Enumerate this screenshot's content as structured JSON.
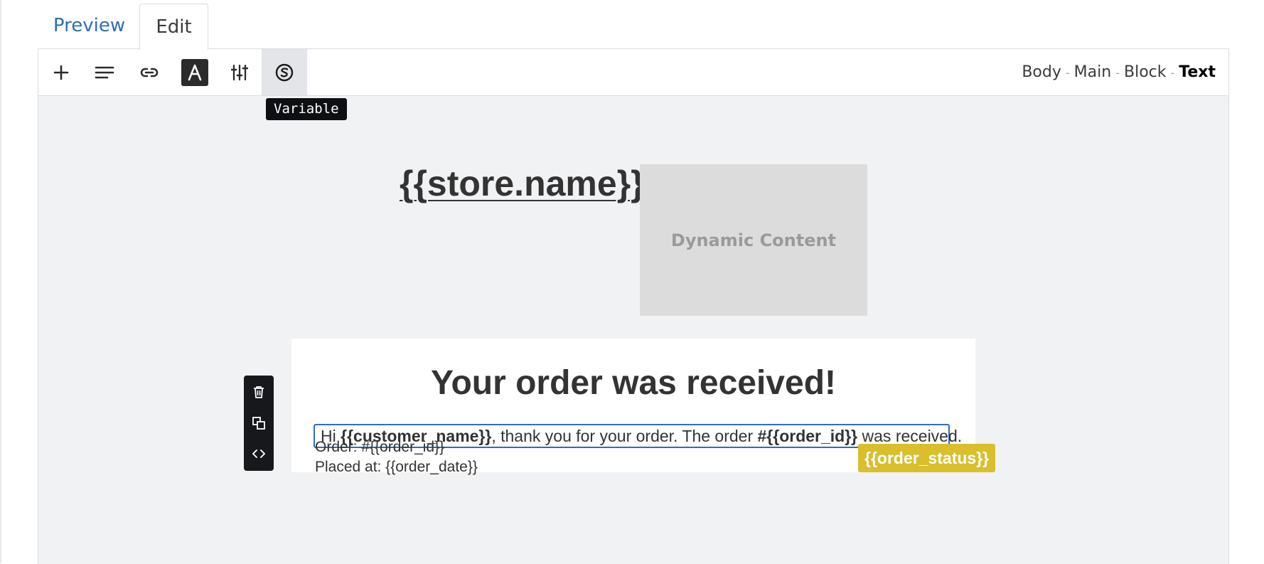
{
  "tabs": [
    {
      "label": "Preview",
      "active": false
    },
    {
      "label": "Edit",
      "active": true
    }
  ],
  "toolbar": {
    "buttons": [
      {
        "icon": "plus-icon",
        "title": "Add"
      },
      {
        "icon": "align-left-icon",
        "title": "Align"
      },
      {
        "icon": "link-icon",
        "title": "Link"
      },
      {
        "icon": "text-style-icon",
        "title": "Text style"
      },
      {
        "icon": "sliders-icon",
        "title": "Settings"
      },
      {
        "icon": "variable-icon",
        "title": "Variable"
      }
    ],
    "tooltip": "Variable"
  },
  "breadcrumb": {
    "items": [
      "Body",
      "Main",
      "Block"
    ],
    "current": "Text",
    "separator": "-"
  },
  "canvas": {
    "store_name": "{{store.name}}",
    "dynamic_content": "Dynamic Content",
    "heading": "Your order was received!",
    "message": {
      "p1": "Hi ",
      "customer_var": "{{customer_name}}",
      "p2": ", thank you for your order. The order ",
      "order_var": "#{{order_id}}",
      "p3": " was received."
    },
    "order_line": "Order: #{{order_id}}",
    "placed_line": "Placed at: {{order_date}}",
    "status_badge": "{{order_status}}"
  },
  "colors": {
    "accent_blue": "#2c6fb0",
    "selection": "#2d6cc6",
    "badge": "#d9bf2c",
    "canvas_bg": "#f1f2f4"
  }
}
